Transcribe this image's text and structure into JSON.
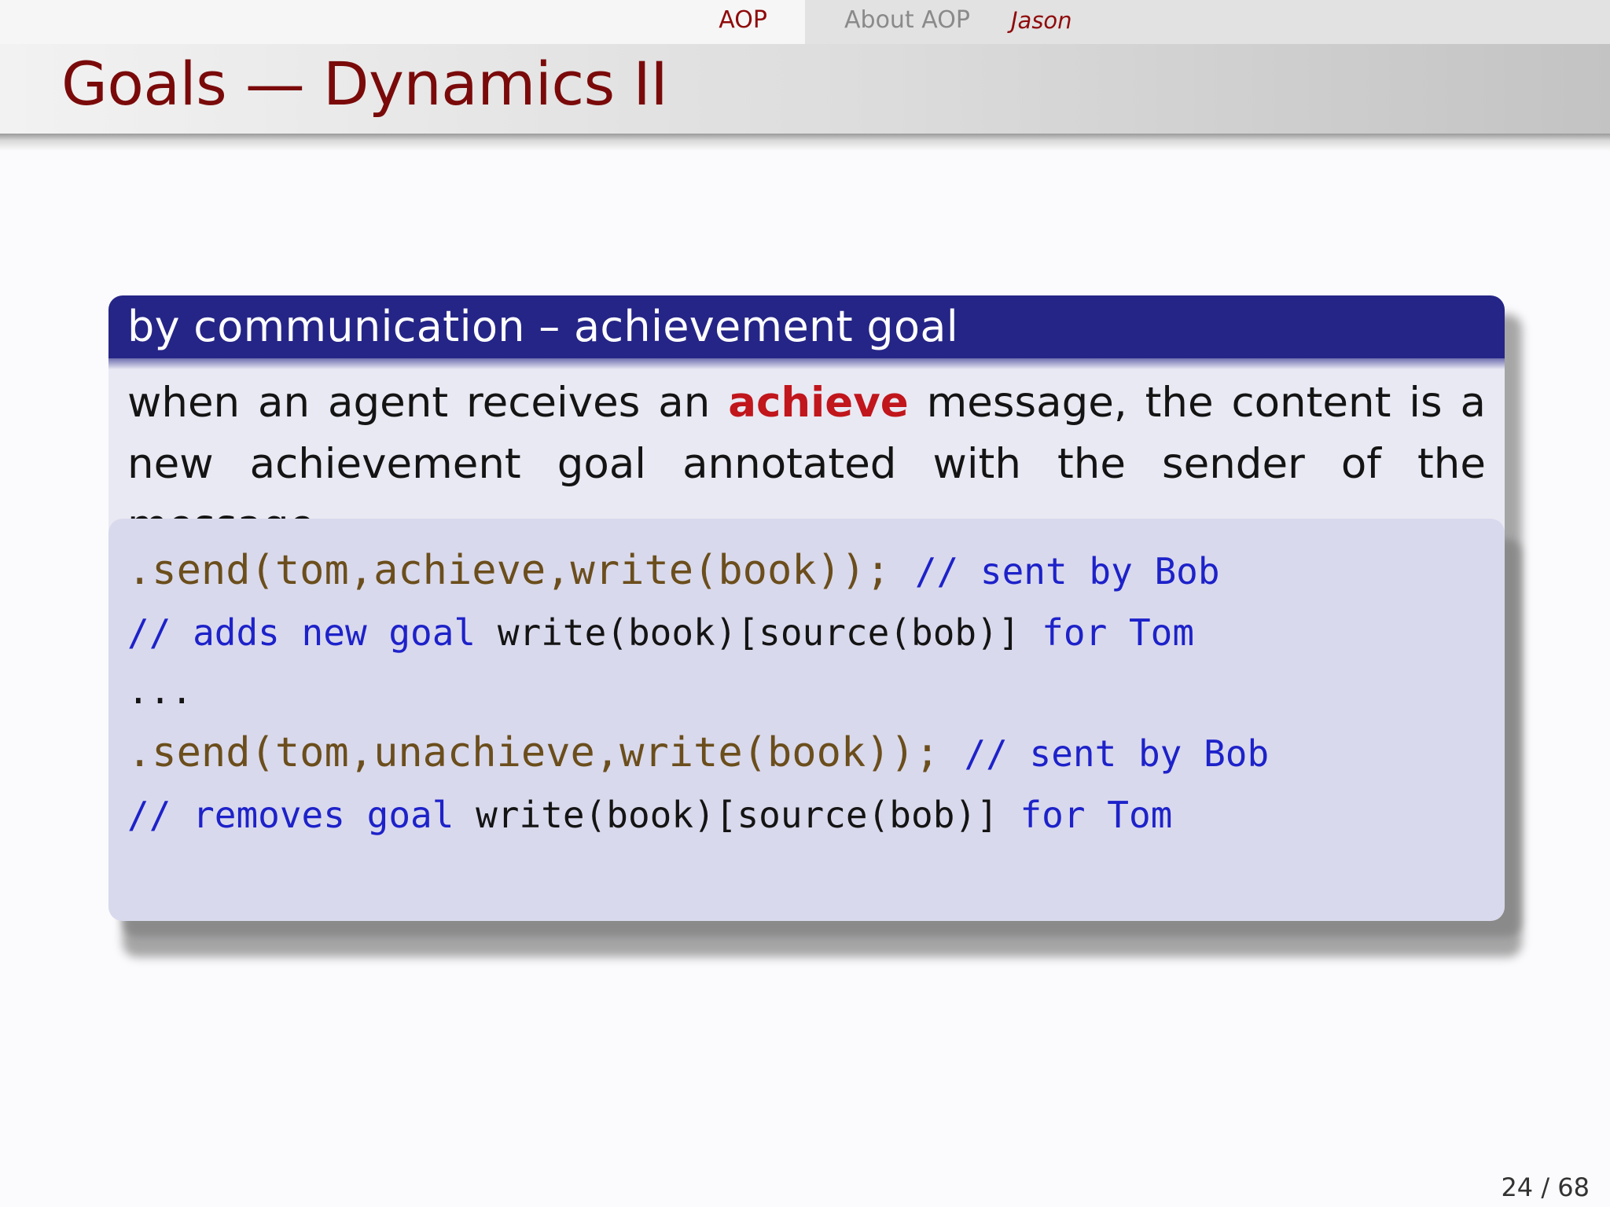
{
  "nav": {
    "section": "AOP",
    "subsection": "About AOP",
    "subsubsection": "Jason"
  },
  "frame": {
    "title": "Goals — Dynamics II"
  },
  "block": {
    "title": "by communication – achievement goal",
    "text_before": "when an agent receives an ",
    "keyword": "achieve",
    "text_after": " message, the content is a new achievement goal annotated with the sender of the message"
  },
  "code": {
    "line1_call": ".send(tom,achieve,write(book));",
    "line1_comment": "// sent by Bob",
    "line2_comment_a": "// adds new goal ",
    "line2_code": "write(book)[source(bob)]",
    "line2_comment_b": " for Tom",
    "line3": "...",
    "line4_call": ".send(tom,unachieve,write(book));",
    "line4_comment": "// sent by Bob",
    "line5_comment_a": "// removes goal ",
    "line5_code": "write(book)[source(bob)]",
    "line5_comment_b": " for Tom"
  },
  "footer": {
    "page": "24 / 68"
  },
  "colors": {
    "title": "#7a0a0a",
    "block_header": "#252587",
    "block_body": "#e9e9f3",
    "code_bg": "#d9d9ed",
    "keyword": "#c0161c",
    "comment": "#1d22c9",
    "call": "#6b4e1c"
  }
}
